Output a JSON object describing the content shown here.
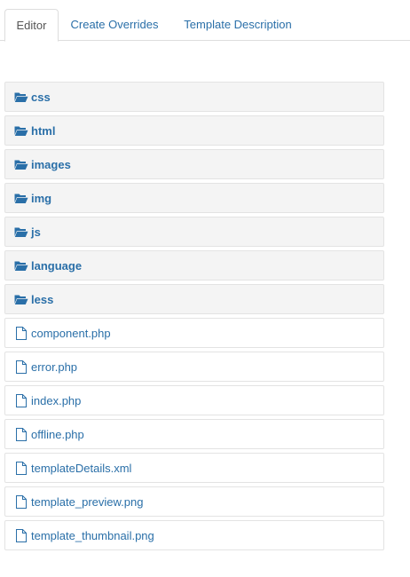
{
  "tabs": [
    {
      "label": "Editor",
      "active": true
    },
    {
      "label": "Create Overrides",
      "active": false
    },
    {
      "label": "Template Description",
      "active": false
    }
  ],
  "folders": [
    {
      "label": "css",
      "icon": "folder-open-icon"
    },
    {
      "label": "html",
      "icon": "folder-open-icon"
    },
    {
      "label": "images",
      "icon": "folder-open-icon"
    },
    {
      "label": "img",
      "icon": "folder-open-icon"
    },
    {
      "label": "js",
      "icon": "folder-open-icon"
    },
    {
      "label": "language",
      "icon": "folder-open-icon"
    },
    {
      "label": "less",
      "icon": "folder-open-icon"
    }
  ],
  "files": [
    {
      "label": "component.php",
      "icon": "file-icon"
    },
    {
      "label": "error.php",
      "icon": "file-icon"
    },
    {
      "label": "index.php",
      "icon": "file-icon"
    },
    {
      "label": "offline.php",
      "icon": "file-icon"
    },
    {
      "label": "templateDetails.xml",
      "icon": "file-icon"
    },
    {
      "label": "template_preview.png",
      "icon": "file-icon"
    },
    {
      "label": "template_thumbnail.png",
      "icon": "file-icon"
    }
  ],
  "colors": {
    "link": "#2a6fa8",
    "folder_bg": "#f4f4f4",
    "border": "#e3e3e3"
  }
}
